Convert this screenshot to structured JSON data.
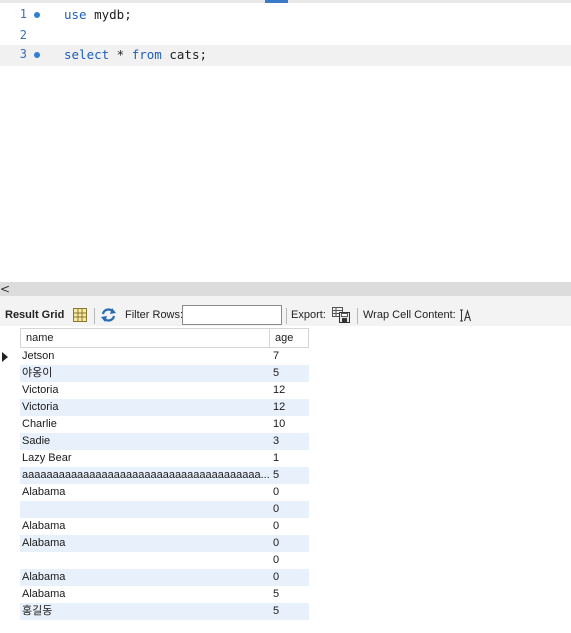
{
  "editor": {
    "lines": [
      {
        "number": "1",
        "tokens": [
          {
            "t": "use",
            "kw": true
          },
          {
            "t": " mydb;",
            "kw": false
          }
        ],
        "active": false,
        "marker": true
      },
      {
        "number": "2",
        "tokens": [],
        "active": false,
        "marker": false
      },
      {
        "number": "3",
        "tokens": [
          {
            "t": "select",
            "kw": true
          },
          {
            "t": " * ",
            "kw": false
          },
          {
            "t": "from",
            "kw": true
          },
          {
            "t": " cats;",
            "kw": false
          }
        ],
        "active": true,
        "marker": true
      }
    ]
  },
  "scrollbar": {
    "left_arrow": "<"
  },
  "toolbar": {
    "result_grid_label": "Result Grid",
    "filter_rows_label": "Filter Rows:",
    "filter_rows_value": "",
    "export_label": "Export:",
    "wrap_label": "Wrap Cell Content:",
    "icons": [
      "grid-view-icon",
      "refresh-icon",
      "export-icon",
      "wrap-text-icon"
    ]
  },
  "grid": {
    "columns": [
      "name",
      "age"
    ],
    "rows": [
      {
        "name": "Jetson",
        "age": "7"
      },
      {
        "name": "야옹이",
        "age": "5"
      },
      {
        "name": "Victoria",
        "age": "12"
      },
      {
        "name": "Victoria",
        "age": "12"
      },
      {
        "name": "Charlie",
        "age": "10"
      },
      {
        "name": "Sadie",
        "age": "3"
      },
      {
        "name": "Lazy Bear",
        "age": "1"
      },
      {
        "name": "aaaaaaaaaaaaaaaaaaaaaaaaaaaaaaaaaaaaaaa...",
        "age": "5"
      },
      {
        "name": "Alabama",
        "age": "0"
      },
      {
        "name": "",
        "age": "0"
      },
      {
        "name": "Alabama",
        "age": "0"
      },
      {
        "name": "Alabama",
        "age": "0"
      },
      {
        "name": "",
        "age": "0"
      },
      {
        "name": "Alabama",
        "age": "0"
      },
      {
        "name": "Alabama",
        "age": "5"
      },
      {
        "name": "홍길동",
        "age": "5"
      }
    ],
    "selected_row": 0
  },
  "colors": {
    "keyword": "#1e5fb8",
    "line_number": "#3c6fb4",
    "alt_row": "#e8f1fb"
  }
}
